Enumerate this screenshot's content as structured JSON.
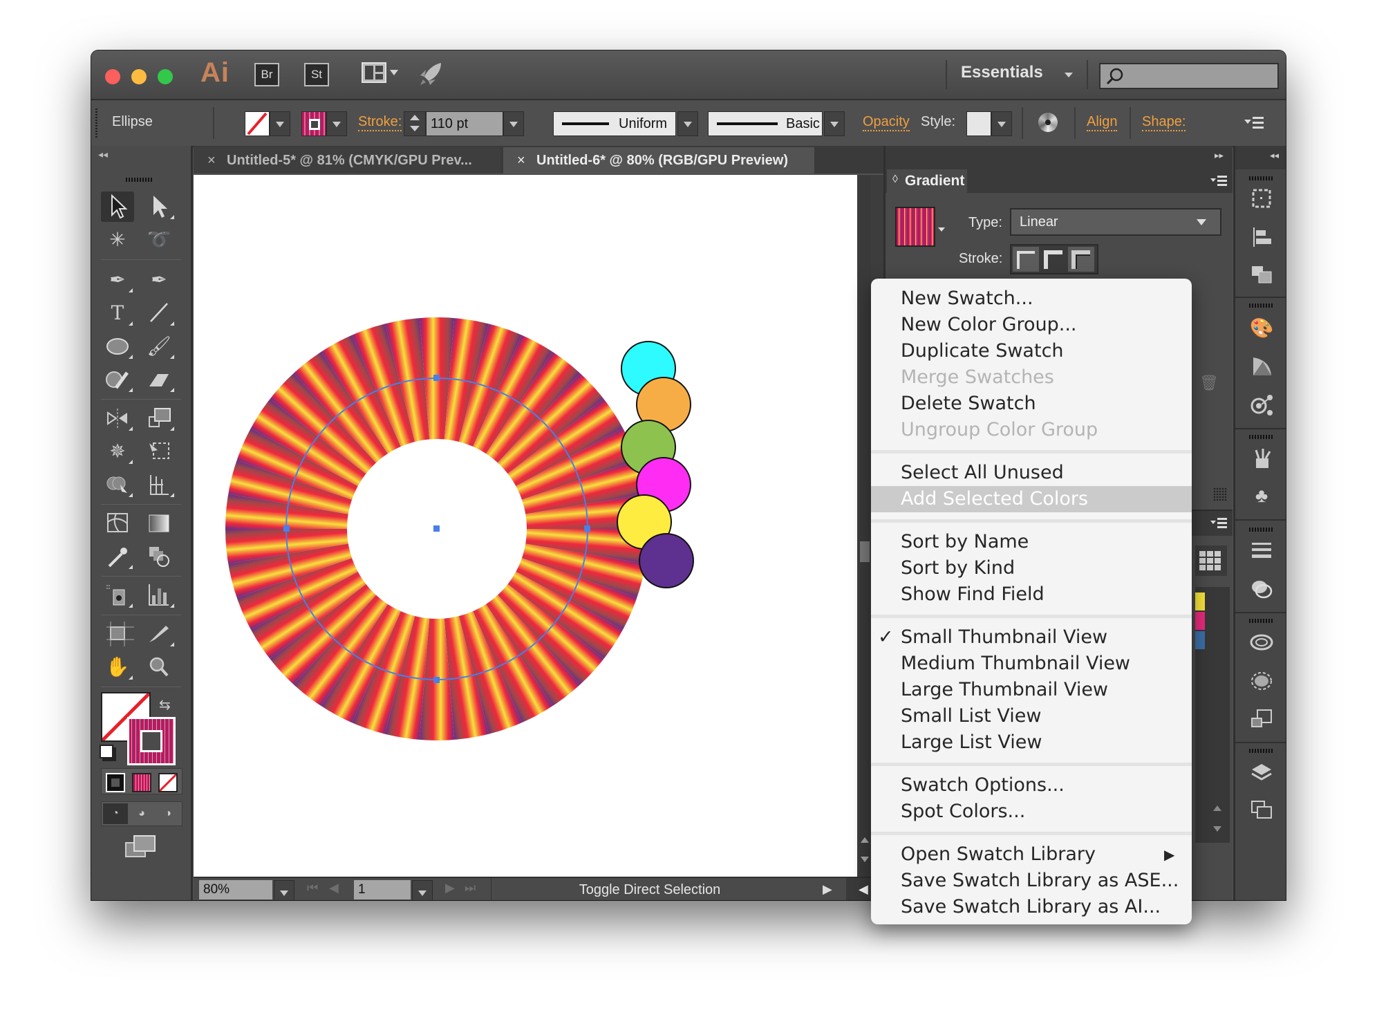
{
  "window": {
    "app_logo": "Ai",
    "bridge_badge": "Br",
    "stock_badge": "St",
    "workspace": "Essentials",
    "search_placeholder": ""
  },
  "control_bar": {
    "selection_type": "Ellipse",
    "stroke_label": "Stroke:",
    "stroke_weight": "110 pt",
    "variable_width_profile": "Uniform",
    "brush_definition": "Basic",
    "opacity_label": "Opacity",
    "style_label": "Style:",
    "align_label": "Align",
    "shape_label": "Shape:"
  },
  "tabs": [
    {
      "label": "Untitled-5* @ 81% (CMYK/GPU Prev...",
      "active": false
    },
    {
      "label": "Untitled-6* @ 80% (RGB/GPU Preview)",
      "active": true
    }
  ],
  "gradient_panel": {
    "title": "Gradient",
    "type_label": "Type:",
    "type_value": "Linear",
    "stroke_label": "Stroke:"
  },
  "status_bar": {
    "zoom": "80%",
    "artboard_number": "1",
    "current_tool_hint": "Toggle Direct Selection"
  },
  "artwork": {
    "ring_colors": [
      "#5b2a8e",
      "#f0283c",
      "#f7e03c",
      "#a0474a"
    ],
    "selection_color": "#4a7fe8",
    "circles": [
      {
        "name": "cyan",
        "color": "#2dfbff"
      },
      {
        "name": "orange",
        "color": "#f7ad46"
      },
      {
        "name": "green",
        "color": "#8dc24f"
      },
      {
        "name": "magenta",
        "color": "#ff2cf4"
      },
      {
        "name": "yellow",
        "color": "#feec40"
      },
      {
        "name": "purple",
        "color": "#5e308f"
      }
    ]
  },
  "swatch_menu": {
    "groups": [
      [
        {
          "label": "New Swatch...",
          "enabled": true
        },
        {
          "label": "New Color Group...",
          "enabled": true
        },
        {
          "label": "Duplicate Swatch",
          "enabled": true
        },
        {
          "label": "Merge Swatches",
          "enabled": false
        },
        {
          "label": "Delete Swatch",
          "enabled": true
        },
        {
          "label": "Ungroup Color Group",
          "enabled": false
        }
      ],
      [
        {
          "label": "Select All Unused",
          "enabled": true
        },
        {
          "label": "Add Selected Colors",
          "enabled": false,
          "highlighted": true
        }
      ],
      [
        {
          "label": "Sort by Name",
          "enabled": true
        },
        {
          "label": "Sort by Kind",
          "enabled": true
        },
        {
          "label": "Show Find Field",
          "enabled": true
        }
      ],
      [
        {
          "label": "Small Thumbnail View",
          "enabled": true,
          "checked": true
        },
        {
          "label": "Medium Thumbnail View",
          "enabled": true
        },
        {
          "label": "Large Thumbnail View",
          "enabled": true
        },
        {
          "label": "Small List View",
          "enabled": true
        },
        {
          "label": "Large List View",
          "enabled": true
        }
      ],
      [
        {
          "label": "Swatch Options...",
          "enabled": true
        },
        {
          "label": "Spot Colors...",
          "enabled": true
        }
      ],
      [
        {
          "label": "Open Swatch Library",
          "enabled": true,
          "submenu": true
        },
        {
          "label": "Save Swatch Library as ASE...",
          "enabled": true
        },
        {
          "label": "Save Swatch Library as AI...",
          "enabled": true
        }
      ]
    ],
    "checkmark": "✓",
    "submenu_arrow": "▶"
  },
  "colors": {
    "accent_orange": "#f0a040",
    "chrome_dark": "#4a4a4a"
  }
}
